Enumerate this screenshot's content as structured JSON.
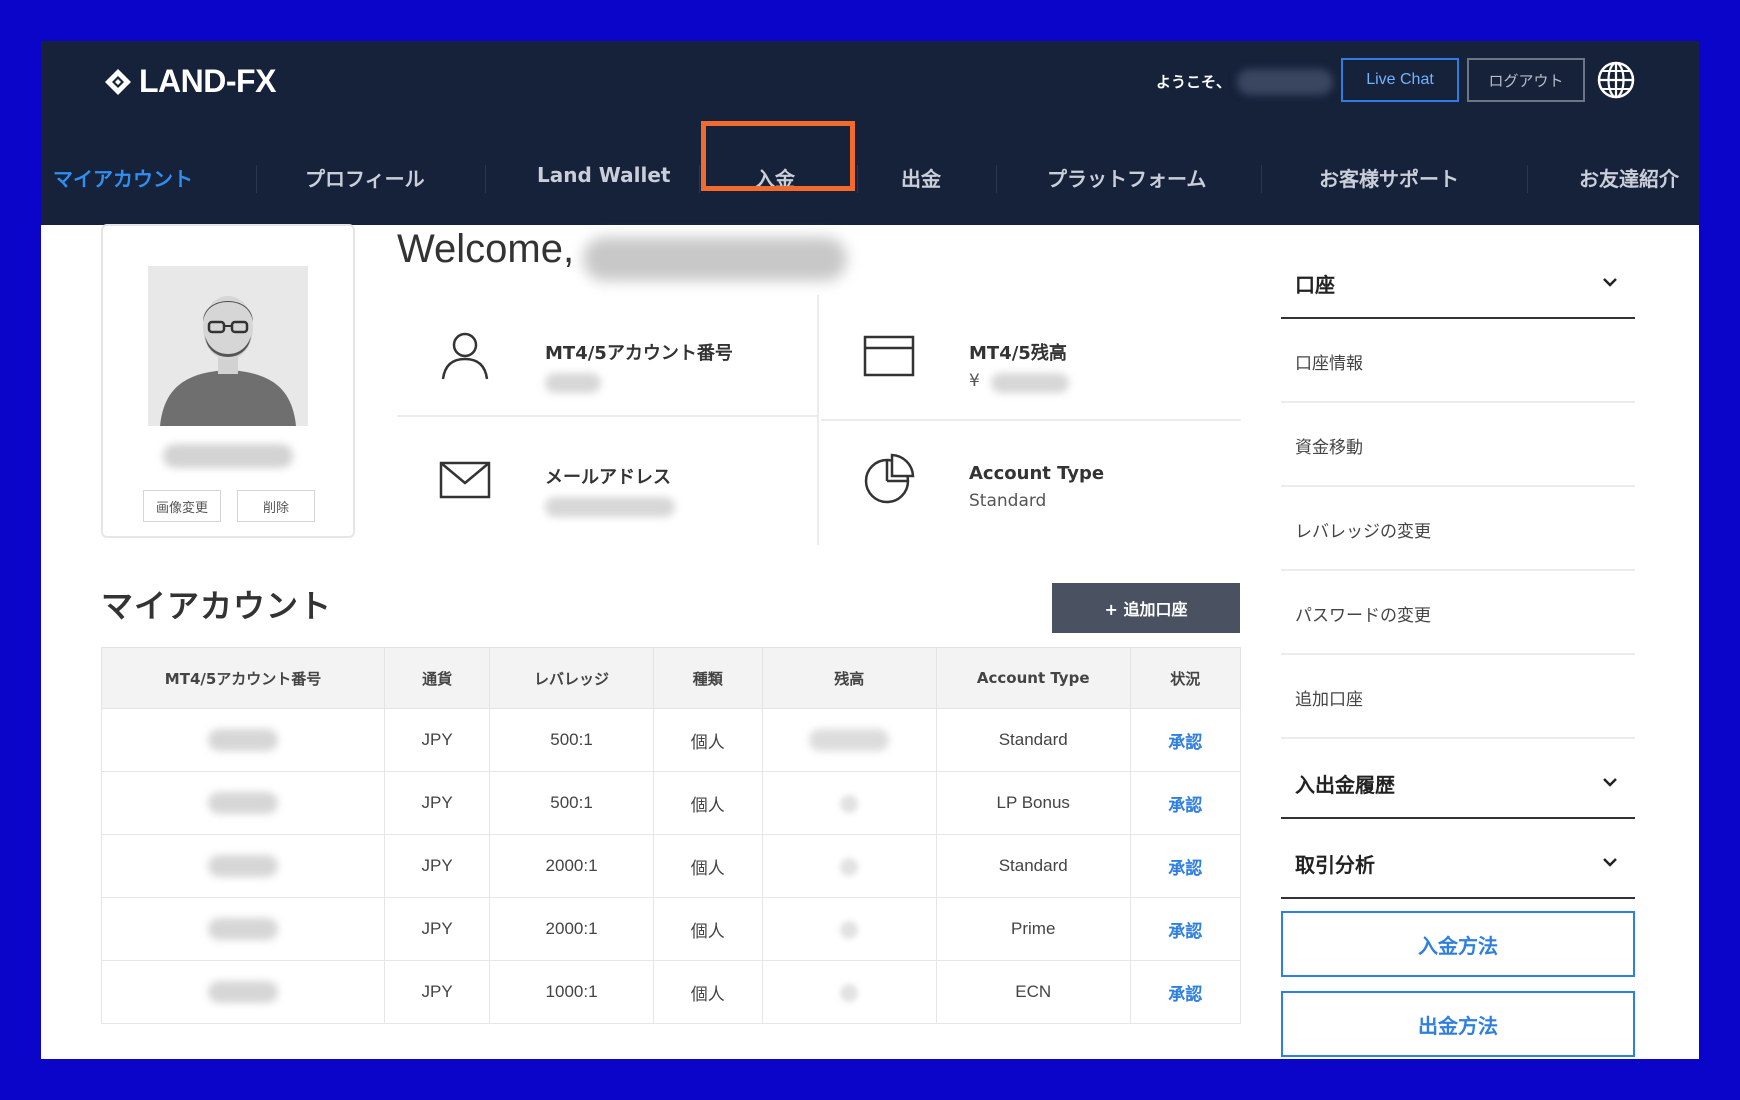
{
  "header": {
    "logo_text": "LAND-FX",
    "welcome_small": "ようこそ、",
    "live_chat_label": "Live Chat",
    "logout_label": "ログアウト"
  },
  "nav": {
    "items": [
      {
        "label": "マイアカウント"
      },
      {
        "label": "プロフィール"
      },
      {
        "label": "Land Wallet"
      },
      {
        "label": "入金"
      },
      {
        "label": "出金"
      },
      {
        "label": "プラットフォーム"
      },
      {
        "label": "お客様サポート"
      },
      {
        "label": "お友達紹介"
      }
    ]
  },
  "profile": {
    "change_image_label": "画像変更",
    "delete_label": "削除"
  },
  "welcome": {
    "title": "Welcome,"
  },
  "info": {
    "account_number_label": "MT4/5アカウント番号",
    "balance_label": "MT4/5残高",
    "balance_currency": "¥",
    "email_label": "メールアドレス",
    "account_type_label": "Account Type",
    "account_type_value": "Standard"
  },
  "my_account": {
    "title": "マイアカウント",
    "add_button_label": "+ 追加口座",
    "columns": [
      "MT4/5アカウント番号",
      "通貨",
      "レバレッジ",
      "種類",
      "残高",
      "Account Type",
      "状況"
    ],
    "rows": [
      {
        "currency": "JPY",
        "leverage": "500:1",
        "kind": "個人",
        "type": "Standard",
        "status": "承認"
      },
      {
        "currency": "JPY",
        "leverage": "500:1",
        "kind": "個人",
        "type": "LP Bonus",
        "status": "承認"
      },
      {
        "currency": "JPY",
        "leverage": "2000:1",
        "kind": "個人",
        "type": "Standard",
        "status": "承認"
      },
      {
        "currency": "JPY",
        "leverage": "2000:1",
        "kind": "個人",
        "type": "Prime",
        "status": "承認"
      },
      {
        "currency": "JPY",
        "leverage": "1000:1",
        "kind": "個人",
        "type": "ECN",
        "status": "承認"
      }
    ]
  },
  "sidebar": {
    "section_account": "口座",
    "items": [
      {
        "label": "口座情報"
      },
      {
        "label": "資金移動"
      },
      {
        "label": "レバレッジの変更"
      },
      {
        "label": "パスワードの変更"
      },
      {
        "label": "追加口座"
      }
    ],
    "section_history": "入出金履歴",
    "section_analysis": "取引分析",
    "deposit_method_label": "入金方法",
    "withdraw_method_label": "出金方法"
  },
  "colors": {
    "header_bg": "#16213a",
    "accent": "#2f8ef0",
    "highlight": "#f26a2e",
    "page_border": "#0a05c8"
  }
}
